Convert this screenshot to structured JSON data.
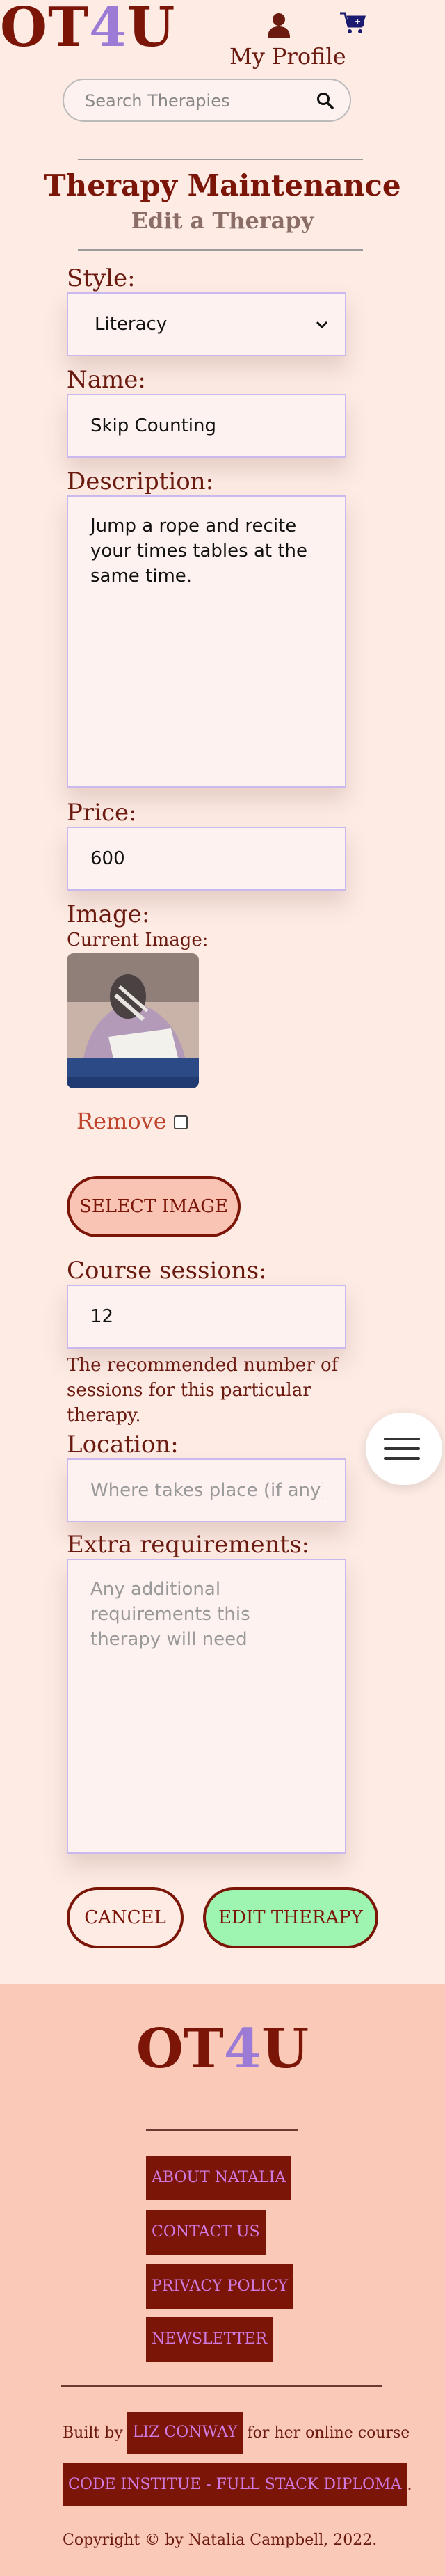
{
  "header": {
    "logo_prefix": "OT",
    "logo_four": "4",
    "logo_suffix": "U",
    "profile_label": "My Profile",
    "profile_icon": "user-icon",
    "cart_icon": "cart-icon",
    "search_placeholder": "Search Therapies",
    "search_icon": "search-icon"
  },
  "page": {
    "title": "Therapy Maintenance",
    "subtitle": "Edit a Therapy"
  },
  "form": {
    "style_label": "Style:",
    "style_value": "Literacy",
    "name_label": "Name:",
    "name_value": "Skip Counting",
    "description_label": "Description:",
    "description_value": "Jump a rope and recite your times tables at the same time.",
    "price_label": "Price:",
    "price_value": "600",
    "image_label": "Image:",
    "current_image_label": "Current Image:",
    "remove_label": "Remove",
    "select_image_button": "SELECT IMAGE",
    "sessions_label": "Course sessions:",
    "sessions_value": "12",
    "sessions_help": "The recommended number of sessions for this particular therapy.",
    "location_label": "Location:",
    "location_placeholder": "Where takes place (if any)",
    "extra_label": "Extra requirements:",
    "extra_placeholder": "Any additional requirements this therapy will need",
    "cancel_button": "CANCEL",
    "submit_button": "EDIT THERAPY"
  },
  "footer": {
    "logo_prefix": "OT",
    "logo_four": "4",
    "logo_suffix": "U",
    "links": [
      "ABOUT NATALIA",
      "CONTACT US",
      "PRIVACY POLICY",
      "NEWSLETTER"
    ],
    "built_by_prefix": "Built by",
    "author_link": "LIZ CONWAY",
    "built_by_suffix": "for her online course",
    "course_link": "CODE INSTITUE - FULL STACK DIPLOMA",
    "course_suffix": ".",
    "copyright": "Copyright © by Natalia Campbell, 2022."
  },
  "colors": {
    "background": "#fdebe4",
    "brand": "#7a1508",
    "accent_four": "#9b7bd6",
    "submit_bg": "#9ef5b2",
    "select_image_bg": "#f9c4b3",
    "footer_bg": "#fbc9b8",
    "footer_link_text": "#d07ae0"
  }
}
